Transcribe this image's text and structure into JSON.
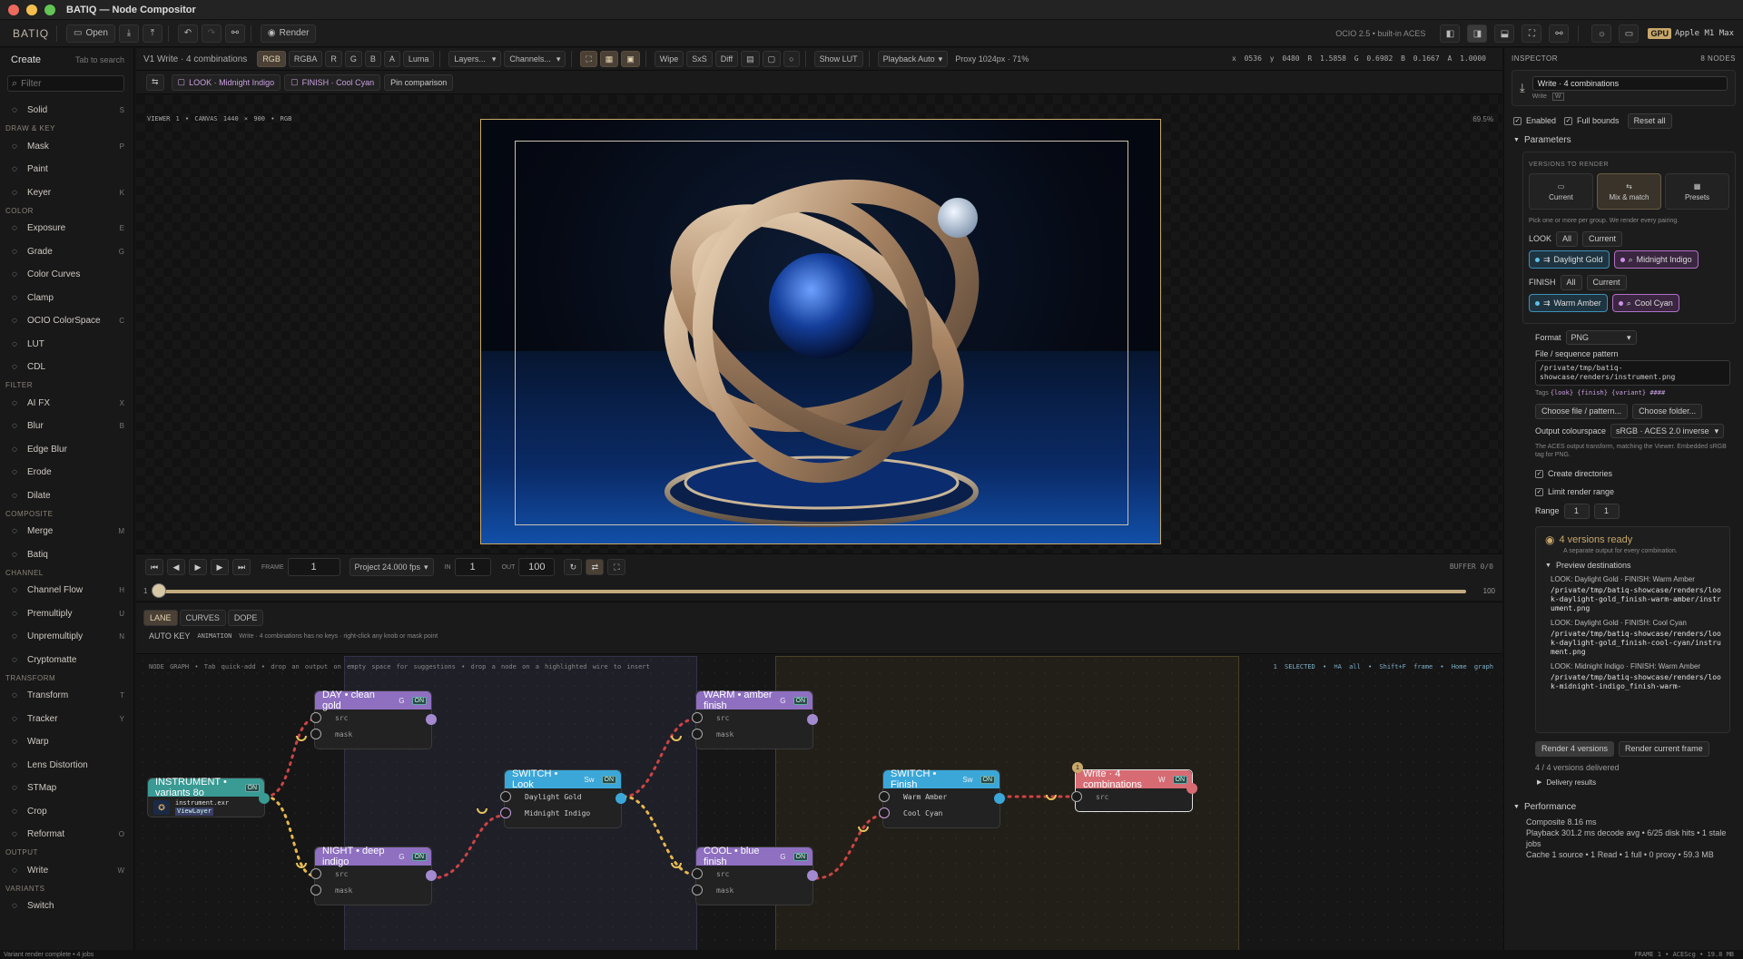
{
  "window": {
    "title": "BATIQ — Node Compositor"
  },
  "toolbar": {
    "brand": "BATIQ",
    "open": "Open",
    "render": "Render",
    "ocio": "OCIO 2.5 • built-in ACES",
    "gpu_badge": "GPU",
    "gpu_name": "Apple M1 Max"
  },
  "sidebar": {
    "title": "Create",
    "hint": "Tab to search",
    "filter_placeholder": "Filter",
    "sections": [
      {
        "label": "",
        "items": [
          {
            "label": "Solid",
            "key": "S",
            "icon": "square-icon"
          }
        ]
      },
      {
        "label": "DRAW & KEY",
        "items": [
          {
            "label": "Mask",
            "key": "P",
            "icon": "pen-icon"
          },
          {
            "label": "Paint",
            "key": "",
            "icon": "brush-icon"
          },
          {
            "label": "Keyer",
            "key": "K",
            "icon": "key-icon"
          }
        ]
      },
      {
        "label": "COLOR",
        "items": [
          {
            "label": "Exposure",
            "key": "E",
            "icon": "exposure-icon"
          },
          {
            "label": "Grade",
            "key": "G",
            "icon": "grade-icon"
          },
          {
            "label": "Color Curves",
            "key": "",
            "icon": "curves-icon"
          },
          {
            "label": "Clamp",
            "key": "",
            "icon": "clamp-icon"
          },
          {
            "label": "OCIO ColorSpace",
            "key": "C",
            "icon": "colorspace-icon"
          },
          {
            "label": "LUT",
            "key": "",
            "icon": "lut-icon"
          },
          {
            "label": "CDL",
            "key": "",
            "icon": "cdl-icon"
          }
        ]
      },
      {
        "label": "FILTER",
        "items": [
          {
            "label": "AI FX",
            "key": "X",
            "icon": "sparkle-icon"
          },
          {
            "label": "Blur",
            "key": "B",
            "icon": "blur-icon"
          },
          {
            "label": "Edge Blur",
            "key": "",
            "icon": "edge-blur-icon"
          },
          {
            "label": "Erode",
            "key": "",
            "icon": "erode-icon"
          },
          {
            "label": "Dilate",
            "key": "",
            "icon": "dilate-icon"
          }
        ]
      },
      {
        "label": "COMPOSITE",
        "items": [
          {
            "label": "Merge",
            "key": "M",
            "icon": "merge-icon"
          },
          {
            "label": "Batiq",
            "key": "",
            "icon": "batiq-icon"
          }
        ]
      },
      {
        "label": "CHANNEL",
        "items": [
          {
            "label": "Channel Flow",
            "key": "H",
            "icon": "channel-icon"
          },
          {
            "label": "Premultiply",
            "key": "U",
            "icon": "premultiply-icon"
          },
          {
            "label": "Unpremultiply",
            "key": "N",
            "icon": "unpremultiply-icon"
          },
          {
            "label": "Cryptomatte",
            "key": "",
            "icon": "cryptomatte-icon"
          }
        ]
      },
      {
        "label": "TRANSFORM",
        "items": [
          {
            "label": "Transform",
            "key": "T",
            "icon": "transform-icon"
          },
          {
            "label": "Tracker",
            "key": "Y",
            "icon": "tracker-icon"
          },
          {
            "label": "Warp",
            "key": "",
            "icon": "warp-icon"
          },
          {
            "label": "Lens Distortion",
            "key": "",
            "icon": "lens-icon"
          },
          {
            "label": "STMap",
            "key": "",
            "icon": "stmap-icon"
          },
          {
            "label": "Crop",
            "key": "",
            "icon": "crop-icon"
          },
          {
            "label": "Reformat",
            "key": "O",
            "icon": "reformat-icon"
          }
        ]
      },
      {
        "label": "OUTPUT",
        "items": [
          {
            "label": "Write",
            "key": "W",
            "icon": "download-icon"
          }
        ]
      },
      {
        "label": "VARIANTS",
        "items": [
          {
            "label": "Switch",
            "key": "",
            "icon": "switch-icon"
          }
        ]
      }
    ]
  },
  "viewer_bar": {
    "label": "V1  Write · 4 combinations",
    "channels": [
      "RGB",
      "RGBA",
      "R",
      "G",
      "B",
      "A",
      "Luma"
    ],
    "active_channel": "RGB",
    "layers": "Layers...",
    "channels_dropdown": "Channels...",
    "compare": [
      "Wipe",
      "SxS",
      "Diff"
    ],
    "show_lut": "Show LUT",
    "playback": "Playback Auto",
    "proxy": "Proxy 1024px · 71%",
    "pixel_info": "x 0536  y 0480  R 1.5858  G 0.6982  B 0.1667  A 1.0000"
  },
  "viewer_bar2": {
    "look_pill": "LOOK · Midnight Indigo",
    "finish_pill": "FINISH · Cool Cyan",
    "pin": "Pin comparison"
  },
  "viewer": {
    "label": "VIEWER 1  •  CANVAS 1440 × 900  •  RGB",
    "zoom": "69.5%"
  },
  "transport": {
    "frame_label": "FRAME",
    "frame": "1",
    "fps": "Project 24.000 fps",
    "in_label": "IN",
    "in": "1",
    "out_label": "OUT",
    "out": "100",
    "buffer": "BUFFER 0/0",
    "start": "1",
    "end": "100",
    "playhead": 0
  },
  "anim": {
    "tabs": [
      "LANE",
      "CURVES",
      "DOPE"
    ],
    "auto_key": "AUTO KEY",
    "animation": "ANIMATION",
    "message": "Write · 4 combinations has no keys · right-click any knob or mask point"
  },
  "graph": {
    "hint": "NODE GRAPH  •  Tab quick-add  •  drop an output on empty space for suggestions  •  drop a node on a highlighted wire to insert",
    "selected": "1 SELECTED",
    "select_all": "⌘A all",
    "frame_sel": "Shift+F frame",
    "home": "Home graph",
    "nodes": {
      "instrument": {
        "title": "INSTRUMENT • variants 8o",
        "file": "instrument.exr",
        "layer": "ViewLayer",
        "on": "ON"
      },
      "day": {
        "title": "DAY • clean gold",
        "type": "G",
        "on": "ON",
        "ports": [
          "src",
          "mask"
        ]
      },
      "night": {
        "title": "NIGHT • deep indigo",
        "type": "G",
        "on": "ON",
        "ports": [
          "src",
          "mask"
        ]
      },
      "switch_look": {
        "title": "SWITCH • Look",
        "type": "Sw",
        "on": "ON",
        "ports": [
          "Daylight Gold",
          "Midnight Indigo"
        ]
      },
      "warm": {
        "title": "WARM • amber finish",
        "type": "G",
        "on": "ON",
        "ports": [
          "src",
          "mask"
        ]
      },
      "cool": {
        "title": "COOL • blue finish",
        "type": "G",
        "on": "ON",
        "ports": [
          "src",
          "mask"
        ]
      },
      "switch_finish": {
        "title": "SWITCH • Finish",
        "type": "Sw",
        "on": "ON",
        "ports": [
          "Warm Amber",
          "Cool Cyan"
        ]
      },
      "write": {
        "title": "Write · 4 combinations",
        "type": "W",
        "on": "ON",
        "ports": [
          "src"
        ],
        "badge": "1"
      }
    }
  },
  "inspector": {
    "title": "INSPECTOR",
    "count": "8 NODES",
    "node_name": "Write · 4 combinations",
    "node_type": "Write",
    "node_key": "W",
    "enabled": "Enabled",
    "full_bounds": "Full bounds",
    "reset_all": "Reset all",
    "parameters": "Parameters",
    "versions_title": "VERSIONS TO RENDER",
    "modes": [
      "Current",
      "Mix & match",
      "Presets"
    ],
    "active_mode": "Mix & match",
    "versions_hint": "Pick one or more per group. We render every pairing.",
    "look_label": "LOOK",
    "finish_label": "FINISH",
    "all": "All",
    "current": "Current",
    "look_options": [
      "Daylight Gold",
      "Midnight Indigo"
    ],
    "finish_options": [
      "Warm Amber",
      "Cool Cyan"
    ],
    "format_label": "Format",
    "format": "PNG",
    "pattern_label": "File / sequence pattern",
    "pattern": "/private/tmp/batiq-showcase/renders/instrument.png",
    "tags_label": "Tags",
    "tags": "{look} {finish} {variant} ####",
    "choose_file": "Choose file / pattern...",
    "choose_folder": "Choose folder...",
    "out_cs_label": "Output colourspace",
    "out_cs": "sRGB · ACES 2.0 inverse",
    "out_cs_hint": "The ACES output transform, matching the Viewer. Embedded sRGB tag for PNG.",
    "create_dirs": "Create directories",
    "limit_range": "Limit render range",
    "range_label": "Range",
    "range_from": "1",
    "range_to": "1",
    "ready_title": "4 versions ready",
    "ready_sub": "A separate output for every combination.",
    "preview_dest": "Preview destinations",
    "destinations": [
      {
        "label": "LOOK: Daylight Gold · FINISH: Warm Amber",
        "path": "/private/tmp/batiq-showcase/renders/look-daylight-gold_finish-warm-amber/instrument.png"
      },
      {
        "label": "LOOK: Daylight Gold · FINISH: Cool Cyan",
        "path": "/private/tmp/batiq-showcase/renders/look-daylight-gold_finish-cool-cyan/instrument.png"
      },
      {
        "label": "LOOK: Midnight Indigo · FINISH: Warm Amber",
        "path": "/private/tmp/batiq-showcase/renders/look-midnight-indigo_finish-warm-"
      }
    ],
    "render_versions": "Render 4 versions",
    "render_current": "Render current frame",
    "delivered": "4 / 4 versions delivered",
    "delivery_results": "Delivery results",
    "performance": "Performance",
    "perf_composite": "Composite  8.16 ms",
    "perf_playback": "Playback  301.2 ms decode avg • 6/25 disk hits • 1 stale jobs",
    "perf_cache": "Cache  1 source • 1 Read • 1 full • 0 proxy • 59.3 MB"
  },
  "status": {
    "left": "Variant render complete • 4 jobs",
    "right": "FRAME 1  •  ACEScg  •  19.8 MB"
  },
  "colors": {
    "accent": "#c8a76a",
    "purple_node": "#8e6fc0",
    "blue_node": "#3ba7d9",
    "write_node": "#d76b73",
    "teal_node": "#3a9a94"
  }
}
